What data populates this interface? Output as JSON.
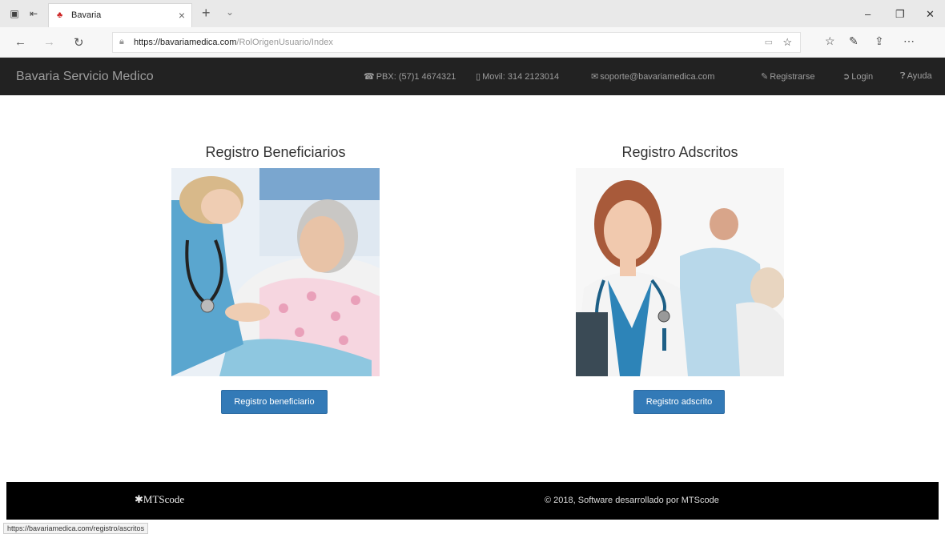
{
  "browser": {
    "tab_title": "Bavaria",
    "url_host": "https://bavariamedica.com",
    "url_path": "/RolOrigenUsuario/Index",
    "status_url": "https://bavariamedica.com/registro/ascritos"
  },
  "site": {
    "brand": "Bavaria Servicio Medico",
    "nav": {
      "pbx": "PBX: (57)1 4674321",
      "movil": "Movil: 314 2123014",
      "email": "soporte@bavariamedica.com",
      "registrarse": "Registrarse",
      "login": "Login",
      "ayuda": "Ayuda"
    }
  },
  "main": {
    "beneficiarios": {
      "title": "Registro Beneficiarios",
      "button": "Registro beneficiario"
    },
    "adscritos": {
      "title": "Registro Adscritos",
      "button": "Registro adscrito"
    }
  },
  "footer": {
    "logo": "MTScode",
    "copyright": "© 2018, Software desarrollado por MTScode"
  },
  "colors": {
    "navbar": "#222222",
    "button": "#337ab7",
    "footer": "#000000"
  }
}
